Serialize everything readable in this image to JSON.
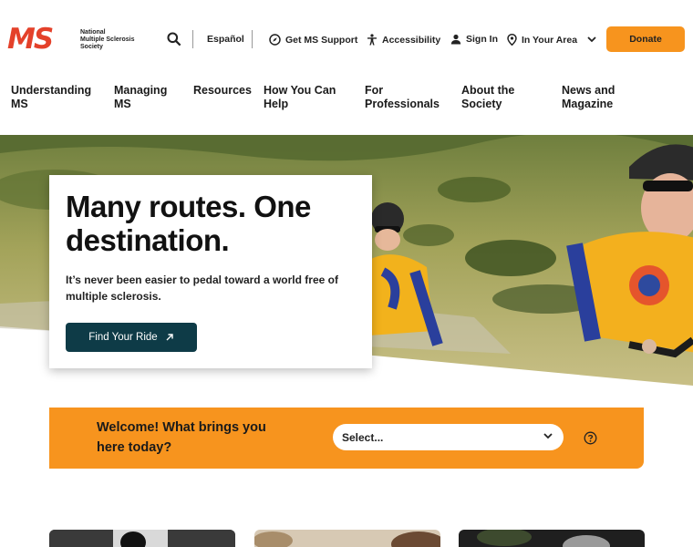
{
  "logo": {
    "mark": "MS",
    "lines": [
      "National",
      "Multiple Sclerosis",
      "Society"
    ]
  },
  "header": {
    "search_icon": "search-icon",
    "espanol": "Español",
    "support": "Get MS Support",
    "accessibility": "Accessibility",
    "signin": "Sign In",
    "area": "In Your Area",
    "donate": "Donate"
  },
  "nav": {
    "items": [
      {
        "label": "Understanding MS"
      },
      {
        "label": "Managing MS"
      },
      {
        "label": "Resources"
      },
      {
        "label": "How You Can Help"
      },
      {
        "label": "For Professionals"
      },
      {
        "label": "About the Society"
      },
      {
        "label": "News and Magazine"
      }
    ]
  },
  "hero": {
    "title": "Many routes. One destination.",
    "subtitle": "It’s never been easier to pedal toward a world free of multiple sclerosis.",
    "cta": "Find Your Ride"
  },
  "welcome": {
    "text": "Welcome! What brings you here today?",
    "select_value": "Select..."
  },
  "colors": {
    "brand_red": "#e4412a",
    "orange": "#f7941e",
    "dark_teal": "#0e3b47"
  }
}
